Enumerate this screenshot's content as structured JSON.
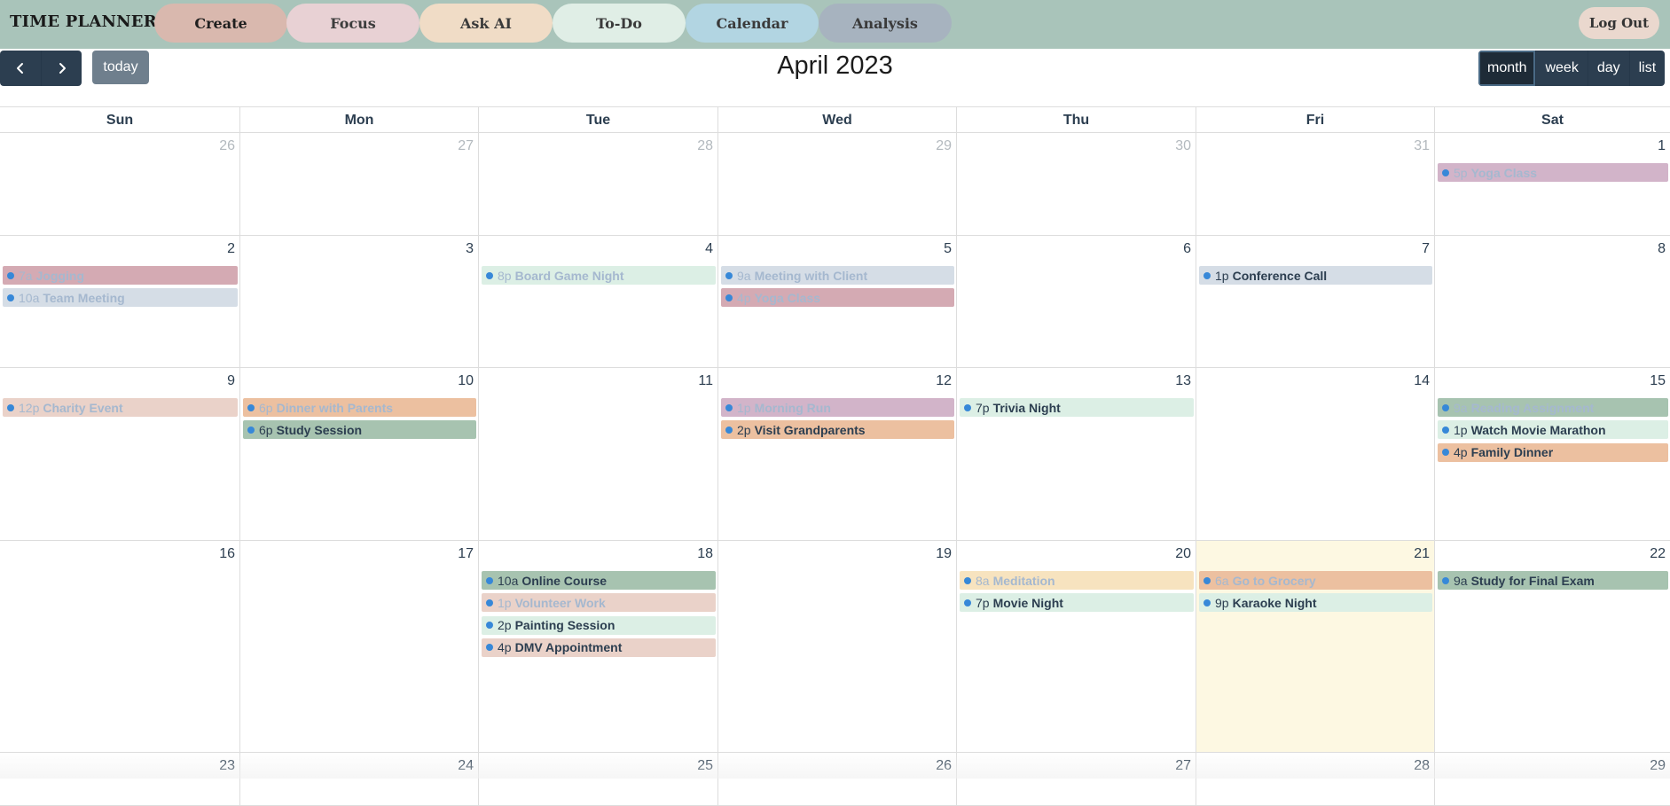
{
  "app": {
    "brand": "TIME PLANNER",
    "nav": [
      "Create",
      "Focus",
      "Ask AI",
      "To-Do",
      "Calendar",
      "Analysis"
    ],
    "logout_label": "Log Out"
  },
  "toolbar": {
    "prev_icon": "chevron-left-icon",
    "next_icon": "chevron-right-icon",
    "today_label": "today",
    "title": "April 2023",
    "views": [
      "month",
      "week",
      "day",
      "list"
    ],
    "active_view": "month"
  },
  "colors": {
    "nav_bar": "#a9c4ba",
    "dark_button": "#2c3e50",
    "today_highlight": "#fdf8e2",
    "event_dot": "#3788d8",
    "palette": {
      "sage": "#a7c3b0",
      "mint": "#dcefe5",
      "rose": "#d4aab3",
      "mauve": "#d2b4c9",
      "peach": "#ecc0a0",
      "blush": "#ead2c9",
      "slate": "#d5dde6",
      "sand": "#f7e3bf"
    }
  },
  "calendar": {
    "weekdays": [
      "Sun",
      "Mon",
      "Tue",
      "Wed",
      "Thu",
      "Fri",
      "Sat"
    ],
    "weeks": [
      [
        {
          "num": "26",
          "other": true,
          "events": []
        },
        {
          "num": "27",
          "other": true,
          "events": []
        },
        {
          "num": "28",
          "other": true,
          "events": []
        },
        {
          "num": "29",
          "other": true,
          "events": []
        },
        {
          "num": "30",
          "other": true,
          "events": []
        },
        {
          "num": "31",
          "other": true,
          "events": []
        },
        {
          "num": "1",
          "events": [
            {
              "time": "5p",
              "title": "Yoga Class",
              "color": "mauve",
              "faded": true
            }
          ]
        }
      ],
      [
        {
          "num": "2",
          "events": [
            {
              "time": "7a",
              "title": "Jogging",
              "color": "rose",
              "faded": true
            },
            {
              "time": "10a",
              "title": "Team Meeting",
              "color": "slate",
              "faded": true
            }
          ]
        },
        {
          "num": "3",
          "events": []
        },
        {
          "num": "4",
          "events": [
            {
              "time": "8p",
              "title": "Board Game Night",
              "color": "mint",
              "faded": true
            }
          ]
        },
        {
          "num": "5",
          "events": [
            {
              "time": "9a",
              "title": "Meeting with Client",
              "color": "slate",
              "faded": true
            },
            {
              "time": "4p",
              "title": "Yoga Class",
              "color": "rose",
              "faded": true
            }
          ]
        },
        {
          "num": "6",
          "events": []
        },
        {
          "num": "7",
          "events": [
            {
              "time": "1p",
              "title": "Conference Call",
              "color": "slate"
            }
          ]
        },
        {
          "num": "8",
          "events": []
        }
      ],
      [
        {
          "num": "9",
          "events": [
            {
              "time": "12p",
              "title": "Charity Event",
              "color": "blush",
              "faded": true
            }
          ]
        },
        {
          "num": "10",
          "events": [
            {
              "time": "6p",
              "title": "Dinner with Parents",
              "color": "peach",
              "faded": true
            },
            {
              "time": "6p",
              "title": "Study Session",
              "color": "sage"
            }
          ]
        },
        {
          "num": "11",
          "events": []
        },
        {
          "num": "12",
          "events": [
            {
              "time": "1p",
              "title": "Morning Run",
              "color": "mauve",
              "faded": true
            },
            {
              "time": "2p",
              "title": "Visit Grandparents",
              "color": "peach"
            }
          ]
        },
        {
          "num": "13",
          "events": [
            {
              "time": "7p",
              "title": "Trivia Night",
              "color": "mint"
            }
          ]
        },
        {
          "num": "14",
          "events": []
        },
        {
          "num": "15",
          "events": [
            {
              "time": "9a",
              "title": "Reading Assignment",
              "color": "sage",
              "faded": true
            },
            {
              "time": "1p",
              "title": "Watch Movie Marathon",
              "color": "mint"
            },
            {
              "time": "4p",
              "title": "Family Dinner",
              "color": "peach"
            }
          ]
        }
      ],
      [
        {
          "num": "16",
          "events": []
        },
        {
          "num": "17",
          "events": []
        },
        {
          "num": "18",
          "events": [
            {
              "time": "10a",
              "title": "Online Course",
              "color": "sage"
            },
            {
              "time": "1p",
              "title": "Volunteer Work",
              "color": "blush",
              "faded": true
            },
            {
              "time": "2p",
              "title": "Painting Session",
              "color": "mint"
            },
            {
              "time": "4p",
              "title": "DMV Appointment",
              "color": "blush"
            }
          ]
        },
        {
          "num": "19",
          "events": []
        },
        {
          "num": "20",
          "events": [
            {
              "time": "8a",
              "title": "Meditation",
              "color": "sand",
              "faded": true
            },
            {
              "time": "7p",
              "title": "Movie Night",
              "color": "mint"
            }
          ]
        },
        {
          "num": "21",
          "today": true,
          "events": [
            {
              "time": "6a",
              "title": "Go to Grocery",
              "color": "peach",
              "faded": true
            },
            {
              "time": "9p",
              "title": "Karaoke Night",
              "color": "mint"
            }
          ]
        },
        {
          "num": "22",
          "events": [
            {
              "time": "9a",
              "title": "Study for Final Exam",
              "color": "sage"
            }
          ]
        }
      ],
      [
        {
          "num": "23",
          "events": []
        },
        {
          "num": "24",
          "events": []
        },
        {
          "num": "25",
          "events": []
        },
        {
          "num": "26",
          "events": []
        },
        {
          "num": "27",
          "events": []
        },
        {
          "num": "28",
          "events": []
        },
        {
          "num": "29",
          "events": []
        }
      ]
    ]
  }
}
